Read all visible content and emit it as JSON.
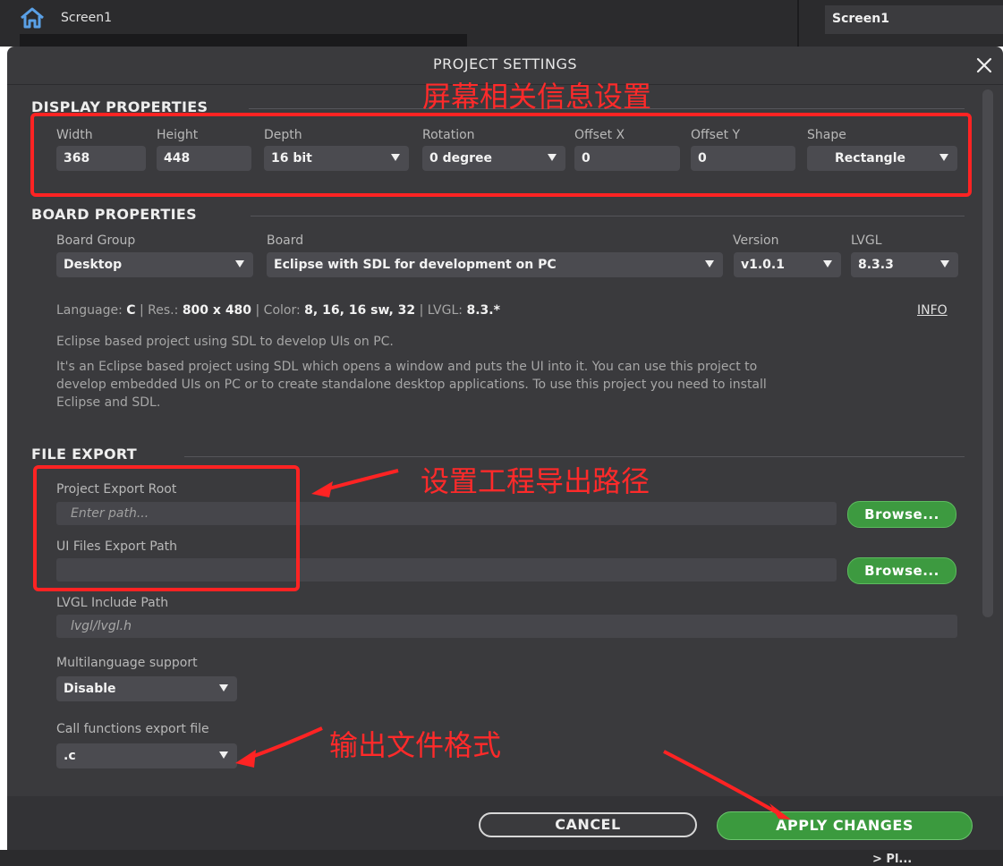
{
  "background": {
    "screen_label": "Screen1",
    "right_panel_tab": "Screen1",
    "bottom_partial_text": "> Pl..."
  },
  "dialog": {
    "title": "PROJECT SETTINGS",
    "close_icon": "close-icon"
  },
  "display_properties": {
    "title": "DISPLAY PROPERTIES",
    "width_label": "Width",
    "width_value": "368",
    "height_label": "Height",
    "height_value": "448",
    "depth_label": "Depth",
    "depth_value": "16 bit",
    "rotation_label": "Rotation",
    "rotation_value": "0 degree",
    "offset_x_label": "Offset X",
    "offset_x_value": "0",
    "offset_y_label": "Offset Y",
    "offset_y_value": "0",
    "shape_label": "Shape",
    "shape_value": "Rectangle"
  },
  "board_properties": {
    "title": "BOARD PROPERTIES",
    "board_group_label": "Board Group",
    "board_group_value": "Desktop",
    "board_label": "Board",
    "board_value": "Eclipse with SDL for development on PC",
    "version_label": "Version",
    "version_value": "v1.0.1",
    "lvgl_label": "LVGL",
    "lvgl_value": "8.3.3",
    "info": {
      "language_key": "Language:",
      "language_val": "C",
      "res_key": "Res.:",
      "res_val": "800 x 480",
      "color_key": "Color:",
      "color_val": "8, 16, 16 sw, 32",
      "lvgl_key": "LVGL:",
      "lvgl_val": "8.3.*",
      "sep": "|"
    },
    "info_link": "INFO",
    "short_description": "Eclipse based project using SDL to develop UIs on PC.",
    "long_description_1": "It's an Eclipse based project using SDL which opens a window and puts the UI into it. You can use this project to",
    "long_description_2": "develop embedded UIs on PC or to create standalone desktop applications. To use this project you need to install",
    "long_description_3": "Eclipse and SDL."
  },
  "file_export": {
    "title": "FILE EXPORT",
    "project_root_label": "Project Export Root",
    "project_root_placeholder": "Enter path...",
    "ui_files_label": "UI Files Export Path",
    "ui_files_value": "",
    "browse_label": "Browse...",
    "lvgl_include_label": "LVGL Include Path",
    "lvgl_include_value": "lvgl/lvgl.h",
    "multilanguage_label": "Multilanguage support",
    "multilanguage_value": "Disable",
    "call_functions_label": "Call functions export file",
    "call_functions_value": ".c"
  },
  "footer": {
    "cancel_label": "CANCEL",
    "apply_label": "APPLY CHANGES"
  },
  "annotations": {
    "display_note": "屏幕相关信息设置",
    "export_path_note": "设置工程导出路径",
    "file_format_note": "输出文件格式",
    "color": "#ff2323"
  }
}
